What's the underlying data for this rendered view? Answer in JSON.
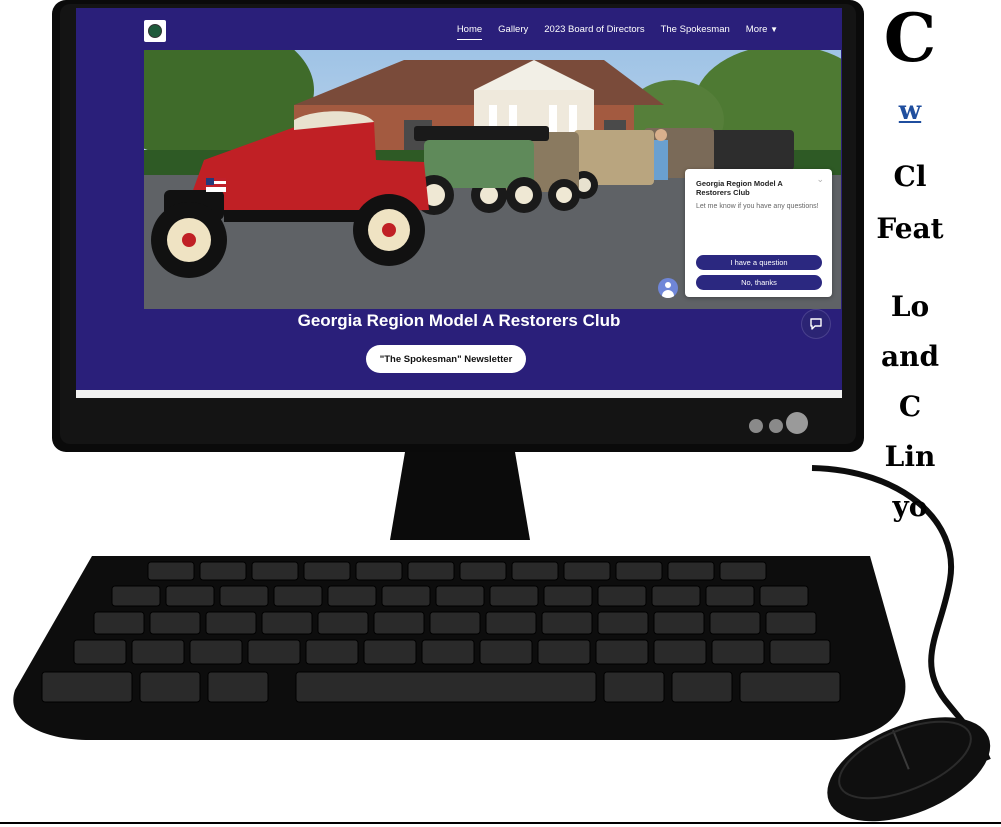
{
  "slide": {
    "heading": "C",
    "url_text": "w",
    "lines": [
      "Cl",
      "Feat",
      "Lo",
      "and",
      "C",
      "Lin",
      "yo"
    ]
  },
  "site": {
    "nav": [
      {
        "label": "Home",
        "active": true
      },
      {
        "label": "Gallery",
        "active": false
      },
      {
        "label": "2023 Board of Directors",
        "active": false
      },
      {
        "label": "The Spokesman",
        "active": false
      },
      {
        "label": "More",
        "active": false
      }
    ],
    "title": "Georgia Region Model A Restorers Club",
    "newsletter_button": "\"The Spokesman\" Newsletter",
    "colors": {
      "background": "#2a1f7a",
      "button": "#2b2880"
    }
  },
  "chat": {
    "title": "Georgia Region Model A Restorers Club",
    "message": "Let me know if you have any questions!",
    "buttons": [
      "I have a question",
      "No, thanks"
    ]
  },
  "icons": [
    "club-logo-icon",
    "caret-down-icon",
    "close-icon",
    "avatar-icon",
    "chat-bubble-icon"
  ]
}
